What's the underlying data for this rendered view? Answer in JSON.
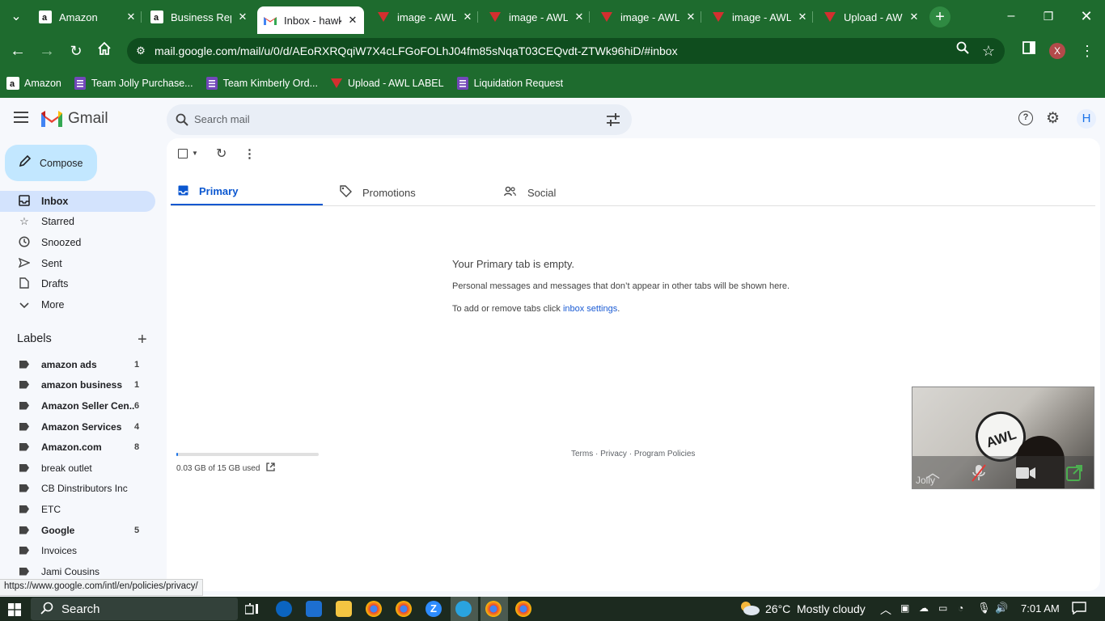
{
  "browser": {
    "tabs": [
      {
        "title": "Amazon",
        "favicon": "amazon-icon"
      },
      {
        "title": "Business Rep",
        "favicon": "amazon-icon"
      },
      {
        "title": "Inbox - hawk",
        "favicon": "gmail-icon"
      },
      {
        "title": "image - AWL",
        "favicon": "awl-icon"
      },
      {
        "title": "image - AWL",
        "favicon": "awl-icon"
      },
      {
        "title": "image - AWL",
        "favicon": "awl-icon"
      },
      {
        "title": "image - AWL",
        "favicon": "awl-icon"
      },
      {
        "title": "Upload - AW",
        "favicon": "awl-icon"
      }
    ],
    "url": "mail.google.com/mail/u/0/d/AEoRXRQqiW7X4cLFGoFOLhJ04fm85sNqaT03CEQvdt-ZTWk96hiD/#inbox",
    "profile_initial": "X",
    "bookmarks": [
      {
        "label": "Amazon",
        "icon": "amazon-icon"
      },
      {
        "label": "Team Jolly Purchase...",
        "icon": "forms-icon"
      },
      {
        "label": "Team Kimberly Ord...",
        "icon": "forms-icon"
      },
      {
        "label": "Upload - AWL LABEL",
        "icon": "awl-icon"
      },
      {
        "label": "Liquidation Request",
        "icon": "forms-icon"
      }
    ],
    "theme_color": "#1e6b2e"
  },
  "gmail": {
    "logo_text": "Gmail",
    "search_placeholder": "Search mail",
    "avatar_initial": "H",
    "compose_label": "Compose",
    "nav": [
      {
        "label": "Inbox",
        "icon": "inbox-icon",
        "active": true
      },
      {
        "label": "Starred",
        "icon": "star-icon"
      },
      {
        "label": "Snoozed",
        "icon": "clock-icon"
      },
      {
        "label": "Sent",
        "icon": "send-icon"
      },
      {
        "label": "Drafts",
        "icon": "draft-icon"
      },
      {
        "label": "More",
        "icon": "chevron-down-icon"
      }
    ],
    "labels_heading": "Labels",
    "labels": [
      {
        "name": "amazon ads",
        "count": "1",
        "bold": true
      },
      {
        "name": "amazon business",
        "count": "1",
        "bold": true
      },
      {
        "name": "Amazon Seller Cen...",
        "count": "6",
        "bold": true
      },
      {
        "name": "Amazon Services",
        "count": "4",
        "bold": true
      },
      {
        "name": "Amazon.com",
        "count": "8",
        "bold": true
      },
      {
        "name": "break outlet",
        "count": "",
        "bold": false
      },
      {
        "name": "CB Dinstributors Inc",
        "count": "",
        "bold": false
      },
      {
        "name": "ETC",
        "count": "",
        "bold": false
      },
      {
        "name": "Google",
        "count": "5",
        "bold": true
      },
      {
        "name": "Invoices",
        "count": "",
        "bold": false
      },
      {
        "name": "Jami Cousins",
        "count": "",
        "bold": false
      }
    ],
    "categories": [
      {
        "label": "Primary",
        "icon": "inbox-icon",
        "active": true
      },
      {
        "label": "Promotions",
        "icon": "tag-icon"
      },
      {
        "label": "Social",
        "icon": "people-icon"
      }
    ],
    "empty": {
      "title": "Your Primary tab is empty.",
      "line1": "Personal messages and messages that don’t appear in other tabs will be shown here.",
      "line2_prefix": "To add or remove tabs click ",
      "line2_link": "inbox settings",
      "line2_suffix": "."
    },
    "storage": {
      "text": "0.03 GB of 15 GB used",
      "used_fraction": 0.002
    },
    "footer_links": [
      "Terms",
      "Privacy",
      "Program Policies"
    ],
    "status_url": "https://www.google.com/intl/en/policies/privacy/"
  },
  "video_overlay": {
    "name": "Jolly"
  },
  "taskbar": {
    "search_label": "Search",
    "weather_temp": "26°C",
    "weather_text": "Mostly cloudy",
    "time": "7:01 AM"
  }
}
